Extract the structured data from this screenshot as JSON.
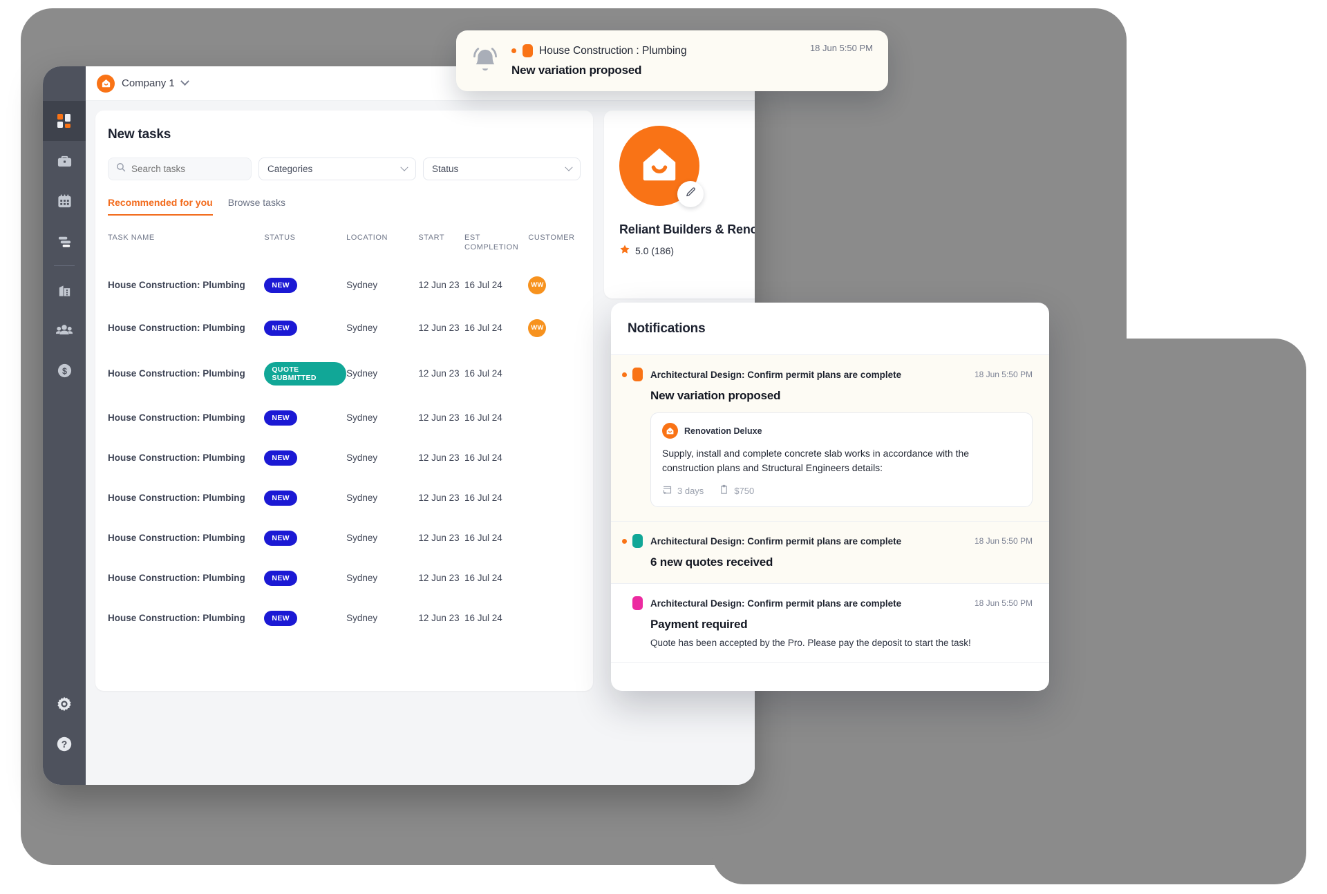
{
  "sidebar": {
    "logo": "brand-logo",
    "items": [
      {
        "name": "dashboard",
        "icon": "grid-icon",
        "active": true
      },
      {
        "name": "jobs",
        "icon": "briefcase-icon",
        "active": false
      },
      {
        "name": "calendar",
        "icon": "calendar-icon",
        "active": false
      },
      {
        "name": "tasks",
        "icon": "list-icon",
        "active": false
      },
      {
        "name": "company",
        "icon": "building-icon",
        "active": false
      },
      {
        "name": "team",
        "icon": "people-icon",
        "active": false
      },
      {
        "name": "payments",
        "icon": "dollar-icon",
        "active": false
      }
    ],
    "bottom_items": [
      {
        "name": "settings",
        "icon": "gear-icon"
      },
      {
        "name": "help",
        "icon": "question-icon"
      }
    ]
  },
  "topbar": {
    "company_name": "Company 1",
    "company_icon": "house-icon",
    "caret_icon": "chevron-down-icon"
  },
  "tasks_panel": {
    "title": "New tasks",
    "search": {
      "placeholder": "Search tasks",
      "value": "",
      "icon": "search-icon"
    },
    "filters": [
      {
        "label": "Categories",
        "name": "categories-select"
      },
      {
        "label": "Status",
        "name": "status-select"
      }
    ],
    "tabs": [
      {
        "label": "Recommended for you",
        "active": true
      },
      {
        "label": "Browse tasks",
        "active": false
      }
    ],
    "columns": [
      "TASK NAME",
      "STATUS",
      "LOCATION",
      "START",
      "EST COMPLETION",
      "CUSTOMER"
    ],
    "rows": [
      {
        "task": "House Construction: Plumbing",
        "status": "NEW",
        "status_type": "new",
        "location": "Sydney",
        "start": "12 Jun 23",
        "est": "16 Jul 24",
        "customer": "WW"
      },
      {
        "task": "House Construction: Plumbing",
        "status": "NEW",
        "status_type": "new",
        "location": "Sydney",
        "start": "12 Jun 23",
        "est": "16 Jul 24",
        "customer": "WW"
      },
      {
        "task": "House Construction: Plumbing",
        "status": "QUOTE SUBMITTED",
        "status_type": "quote",
        "location": "Sydney",
        "start": "12 Jun 23",
        "est": "16 Jul 24",
        "customer": ""
      },
      {
        "task": "House Construction: Plumbing",
        "status": "NEW",
        "status_type": "new",
        "location": "Sydney",
        "start": "12 Jun 23",
        "est": "16 Jul 24",
        "customer": ""
      },
      {
        "task": "House Construction: Plumbing",
        "status": "NEW",
        "status_type": "new",
        "location": "Sydney",
        "start": "12 Jun 23",
        "est": "16 Jul 24",
        "customer": ""
      },
      {
        "task": "House Construction: Plumbing",
        "status": "NEW",
        "status_type": "new",
        "location": "Sydney",
        "start": "12 Jun 23",
        "est": "16 Jul 24",
        "customer": ""
      },
      {
        "task": "House Construction: Plumbing",
        "status": "NEW",
        "status_type": "new",
        "location": "Sydney",
        "start": "12 Jun 23",
        "est": "16 Jul 24",
        "customer": ""
      },
      {
        "task": "House Construction: Plumbing",
        "status": "NEW",
        "status_type": "new",
        "location": "Sydney",
        "start": "12 Jun 23",
        "est": "16 Jul 24",
        "customer": ""
      },
      {
        "task": "House Construction: Plumbing",
        "status": "NEW",
        "status_type": "new",
        "location": "Sydney",
        "start": "12 Jun 23",
        "est": "16 Jul 24",
        "customer": ""
      }
    ]
  },
  "profile_card": {
    "name": "Reliant Builders & Renovators",
    "rating": "5.0 (186)",
    "star_icon": "star-icon",
    "avatar_icon": "house-icon",
    "edit_icon": "pencil-icon",
    "settings_icon": "gear-icon"
  },
  "toast": {
    "bell_icon": "bell-icon",
    "source": "House Construction : Plumbing",
    "title": "New variation proposed",
    "time": "18 Jun 5:50 PM",
    "chip_color": "#f97316"
  },
  "notifications": {
    "title": "Notifications",
    "items": [
      {
        "source": "Architectural Design: Confirm permit plans are complete",
        "time": "18 Jun 5:50 PM",
        "title": "New variation proposed",
        "chip_color": "#f97316",
        "unread": true,
        "quote": {
          "company": "Renovation Deluxe",
          "text": "Supply, install and complete concrete slab works in accordance with the construction plans and Structural Engineers details:",
          "duration": "3 days",
          "price": "$750",
          "duration_icon": "calendar-arrow-icon",
          "price_icon": "clipboard-icon"
        }
      },
      {
        "source": "Architectural Design: Confirm permit plans are complete",
        "time": "18 Jun 5:50 PM",
        "title": "6 new quotes received",
        "chip_color": "#11a797",
        "unread": true
      },
      {
        "source": "Architectural Design: Confirm permit plans are complete",
        "time": "18 Jun 5:50 PM",
        "title": "Payment required",
        "description": "Quote has been accepted by the Pro. Please pay the deposit to start the task!",
        "chip_color": "#ec2aa0",
        "unread": false
      }
    ]
  },
  "colors": {
    "brand_orange": "#f97316",
    "accent_orange": "#f26a1b",
    "badge_new": "#1b19d4",
    "badge_quote": "#11a797",
    "badge_pink": "#ec2aa0",
    "sidebar": "#4e525d",
    "frame": "#8b8b8b"
  }
}
